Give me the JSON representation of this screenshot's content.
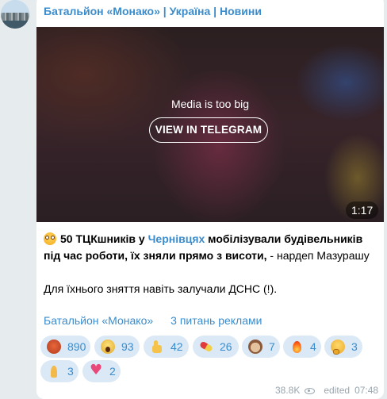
{
  "channel": {
    "name": "Батальйон «Монако» | Україна | Новини"
  },
  "media": {
    "note": "Media is too big",
    "button_label": "VIEW IN TELEGRAM",
    "duration": "1:17"
  },
  "post": {
    "line1_pre": "50 ТЦКшників у ",
    "line1_link": "Чернівцях",
    "line1_post": " мобілізували будівельників під час роботи, їх зняли прямо з висоти,",
    "line1_tail": " - нардеп Мазурашу",
    "para2": "Для їхнього зняття навіть залучали ДСНС (!).",
    "link1": "Батальйон «Монако»",
    "link2": "3 питань реклами"
  },
  "reactions": [
    {
      "icon": "angry-face-icon",
      "count": "890"
    },
    {
      "icon": "screaming-face-icon",
      "count": "93"
    },
    {
      "icon": "thumbs-up-icon",
      "count": "42"
    },
    {
      "icon": "pill-icon",
      "count": "26"
    },
    {
      "icon": "see-no-evil-monkey-icon",
      "count": "7"
    },
    {
      "icon": "fire-icon",
      "count": "4"
    },
    {
      "icon": "thinking-face-icon",
      "count": "3"
    },
    {
      "icon": "praying-hands-icon",
      "count": "3"
    },
    {
      "icon": "heart-with-arrow-icon",
      "count": "2"
    }
  ],
  "footer": {
    "views": "38.8K",
    "edited_label": "edited",
    "time": "07:48"
  },
  "colors": {
    "accent": "#3a8ccc",
    "reaction_bg": "#dbe9f6",
    "page_bg": "#e6ebee"
  }
}
